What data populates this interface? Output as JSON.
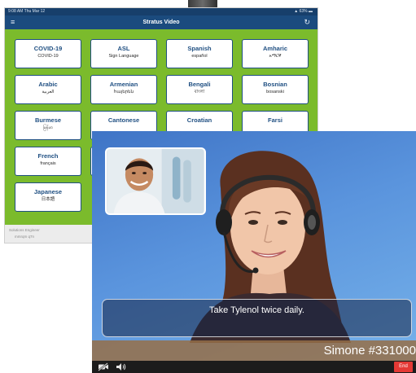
{
  "tablet": {
    "status_time": "9:08 AM  Thu Mar 12",
    "status_battery": "▲ 63% ▬",
    "title": "Stratus Video",
    "menu_icon": "≡",
    "refresh_icon": "↻",
    "languages": [
      {
        "name": "COVID-19",
        "native": "COVID-19"
      },
      {
        "name": "ASL",
        "native": "Sign Language"
      },
      {
        "name": "Spanish",
        "native": "español"
      },
      {
        "name": "Amharic",
        "native": "አማርኛ"
      },
      {
        "name": "Arabic",
        "native": "العربية"
      },
      {
        "name": "Armenian",
        "native": "հայերեն"
      },
      {
        "name": "Bengali",
        "native": "বাংলা"
      },
      {
        "name": "Bosnian",
        "native": "bosanski"
      },
      {
        "name": "Burmese",
        "native": "မြန်မာ"
      },
      {
        "name": "Cantonese",
        "native": ""
      },
      {
        "name": "Croatian",
        "native": ""
      },
      {
        "name": "Farsi",
        "native": ""
      },
      {
        "name": "French",
        "native": "français"
      },
      {
        "name": "Japanese",
        "native": "日本語"
      }
    ],
    "footer_line1": "Solutions Engineer",
    "footer_line2": "mmrqm q7n"
  },
  "call": {
    "caption": "Take Tylenol twice daily.",
    "interpreter_name": "Simone #331000",
    "camera_off_icon": "video-off-icon",
    "speaker_icon": "speaker-icon",
    "end_label": "End",
    "end_color": "#e53935"
  },
  "colors": {
    "tablet_background": "#7bbb2c",
    "header": "#1b4b7e",
    "button_border": "#1f4f82"
  }
}
